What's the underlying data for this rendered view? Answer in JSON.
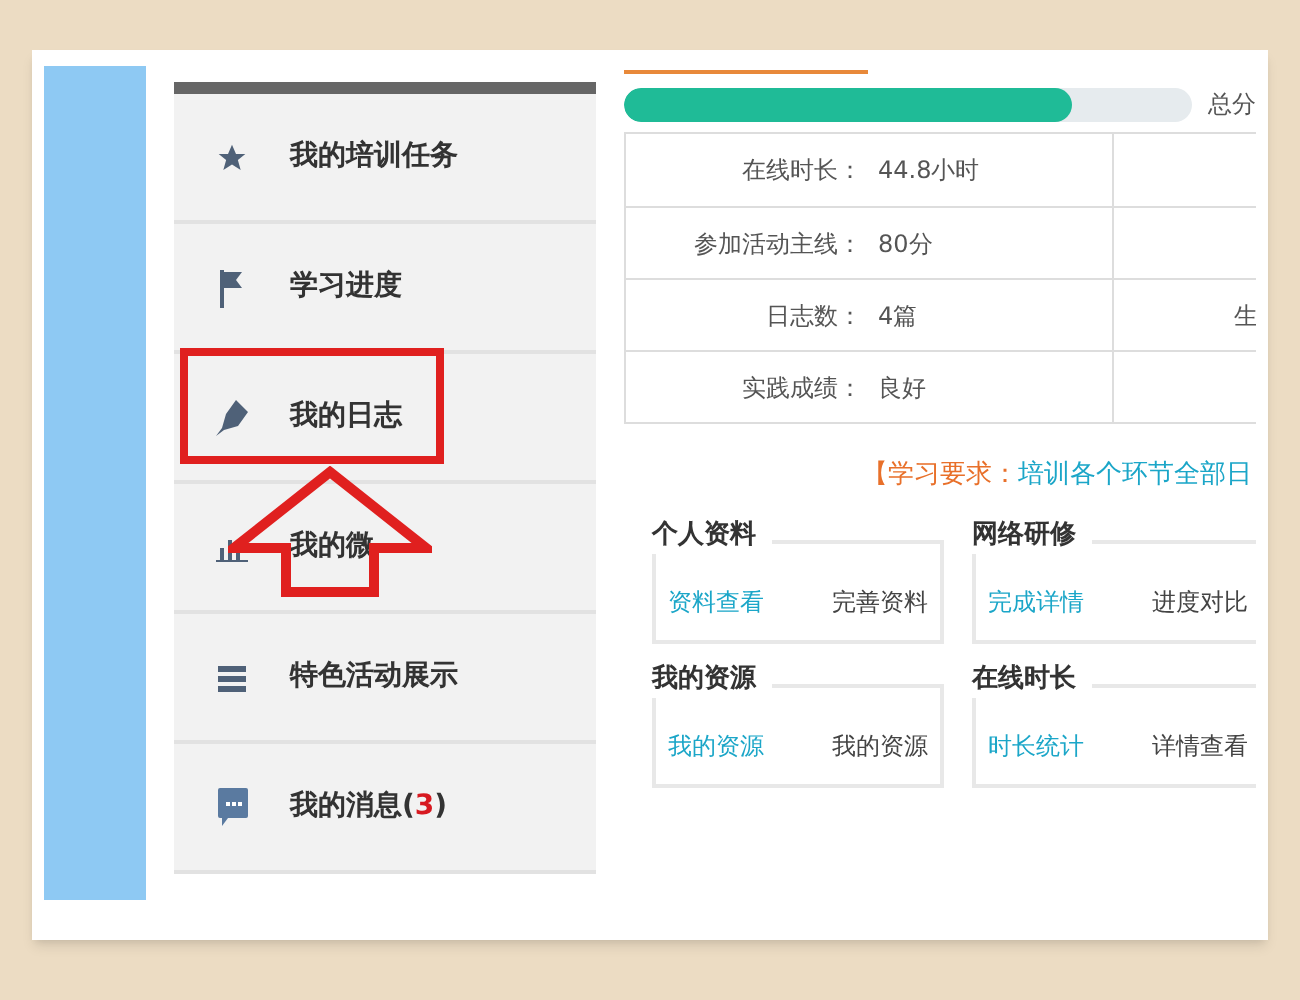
{
  "sidebar": {
    "items": [
      {
        "label": "我的培训任务",
        "highlighted": false
      },
      {
        "label": "学习进度",
        "highlighted": false
      },
      {
        "label": "我的日志",
        "highlighted": true
      },
      {
        "label": "我的微",
        "highlighted": false
      },
      {
        "label": "特色活动展示",
        "highlighted": false
      },
      {
        "label": "我的消息(**3**)",
        "highlighted": false
      }
    ]
  },
  "progress": {
    "level": 0.79,
    "label": "总分"
  },
  "stats_table": {
    "rows": [
      {
        "label": "在线时长：",
        "value": "44.8小时"
      },
      {
        "label": "参加活动主线：",
        "value": "80分"
      },
      {
        "label": "日志数：",
        "value": "4篇",
        "column_2": "生"
      },
      {
        "label": "实践成绩：",
        "value": "良好"
      }
    ]
  },
  "requirement": {
    "label": "【学习要求：",
    "text": "培训各个环节全部日"
  },
  "panels": [
    {
      "title": "个人资料",
      "links": [
        "资料查看",
        "完善资料"
      ]
    },
    {
      "title": "网络研修",
      "links": [
        "完成详情",
        "进度对比"
      ]
    },
    {
      "title": "我的资源",
      "links": [
        "我的资源",
        "我的资源"
      ]
    },
    {
      "title": "在线时长",
      "links": [
        "时长统计",
        "详情查看"
      ]
    }
  ]
}
